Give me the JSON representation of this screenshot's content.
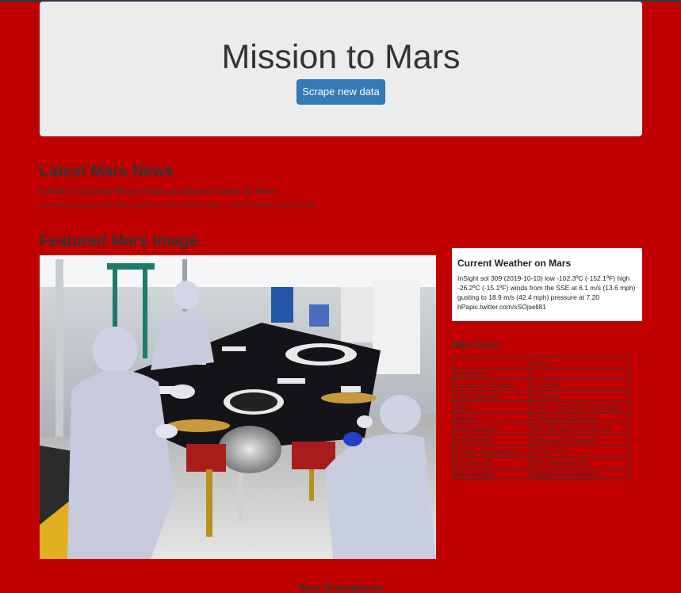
{
  "header": {
    "title": "Mission to Mars",
    "scrape_button": "Scrape new data"
  },
  "news": {
    "heading": "Latest Mars News",
    "title": "NASA's Curiosity Rover Finds an Ancient Oasis on Mars",
    "paragraph": "New evidence suggests salty, shallow ponds once dotted a Martian crater — a sign of the planet's drying climate."
  },
  "featured": {
    "heading": "Featured Mars Image"
  },
  "weather": {
    "heading": "Current Weather on Mars",
    "text": "InSight sol 309 (2019-10-10) low -102.3ºC (-152.1ºF) high -26.2ºC (-15.1ºF) winds from the SSE at 6.1 m/s (13.6 mph) gusting to 18.9 m/s (42.4 mph) pressure at 7.20 hPapic.twitter.com/sSOjsell81"
  },
  "facts": {
    "heading": "Mars Facts",
    "columns": [
      "",
      "Value"
    ],
    "rows": [
      {
        "label": "Description",
        "value": ""
      },
      {
        "label": "Equatorial Diameter:",
        "value": "6,792 km"
      },
      {
        "label": "Polar Diameter:",
        "value": "6,752 km"
      },
      {
        "label": "Mass:",
        "value": "6.39 × 10^23 kg (0.11 Earths)"
      },
      {
        "label": "Moons:",
        "value": "2 (Phobos & Deimos)"
      },
      {
        "label": "Orbit Distance:",
        "value": "227,943,824 km (1.38 AU)"
      },
      {
        "label": "Orbit Period:",
        "value": "687 days (1.9 years)"
      },
      {
        "label": "Surface Temperature:",
        "value": "-87 to -5 °C"
      },
      {
        "label": "First Record:",
        "value": "2nd millennium BC"
      },
      {
        "label": "Recorded By:",
        "value": "Egyptian astronomers"
      }
    ]
  },
  "hemispheres": {
    "heading": "Mars Hemispheres"
  }
}
